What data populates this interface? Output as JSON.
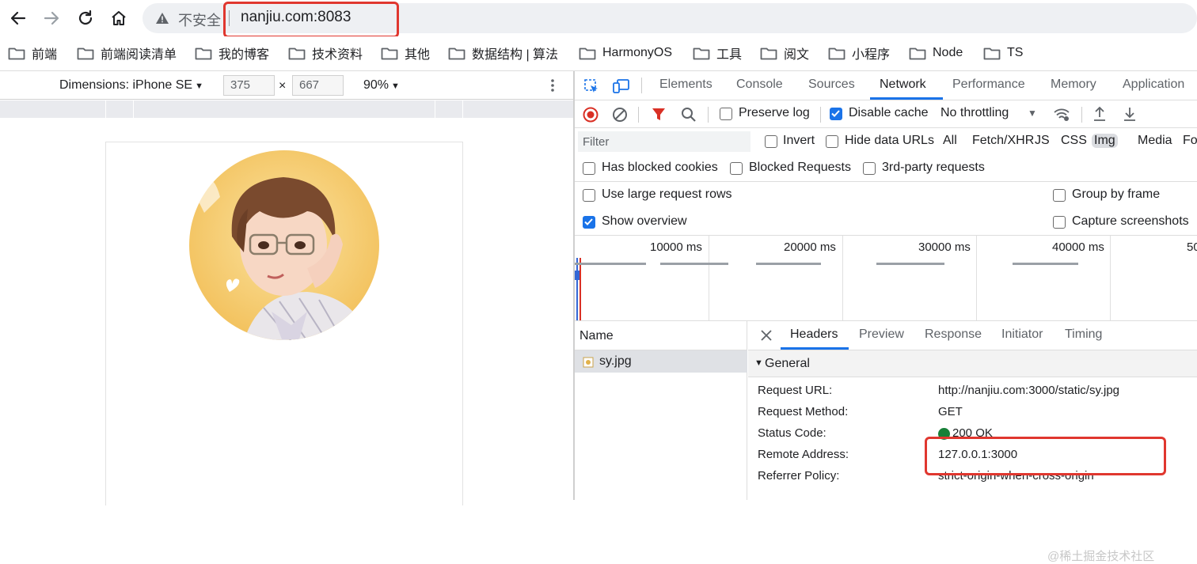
{
  "browser": {
    "security_label": "不安全",
    "address": "nanjiu.com:8083"
  },
  "bookmarks": [
    "前端",
    "前端阅读清单",
    "我的博客",
    "技术资料",
    "其他",
    "数据结构 | 算法",
    "HarmonyOS",
    "工具",
    "阅文",
    "小程序",
    "Node",
    "TS"
  ],
  "device_toolbar": {
    "device": "Dimensions: iPhone SE",
    "width": "375",
    "times": "×",
    "height": "667",
    "zoom": "90%"
  },
  "devtools": {
    "tabs": [
      "Elements",
      "Console",
      "Sources",
      "Network",
      "Performance",
      "Memory",
      "Application"
    ],
    "active_tab": "Network",
    "toolbar": {
      "preserve_log": "Preserve log",
      "disable_cache": "Disable cache",
      "throttling": "No throttling"
    },
    "filter": {
      "placeholder": "Filter",
      "invert": "Invert",
      "hide_data_urls": "Hide data URLs",
      "types": [
        "All",
        "Fetch/XHR",
        "JS",
        "CSS",
        "Img",
        "Media",
        "Fo"
      ],
      "active_type": "Img"
    },
    "options_row1": [
      "Has blocked cookies",
      "Blocked Requests",
      "3rd-party requests"
    ],
    "settings": {
      "large_rows": "Use large request rows",
      "group_by_frame": "Group by frame",
      "show_overview": "Show overview",
      "capture_screenshots": "Capture screenshots"
    },
    "timeline": {
      "labels": [
        "10000 ms",
        "20000 ms",
        "30000 ms",
        "40000 ms",
        "50"
      ]
    },
    "requests": {
      "column_name": "Name",
      "items": [
        "sy.jpg"
      ]
    },
    "details": {
      "tabs": [
        "Headers",
        "Preview",
        "Response",
        "Initiator",
        "Timing"
      ],
      "active_tab": "Headers",
      "section": "General",
      "rows": [
        {
          "key": "Request URL:",
          "value": "http://nanjiu.com:3000/static/sy.jpg"
        },
        {
          "key": "Request Method:",
          "value": "GET"
        },
        {
          "key": "Status Code:",
          "value": "200 OK"
        },
        {
          "key": "Remote Address:",
          "value": "127.0.0.1:3000"
        },
        {
          "key": "Referrer Policy:",
          "value": "strict-origin-when-cross-origin"
        }
      ]
    }
  },
  "watermark": "@稀土掘金技术社区",
  "colors": {
    "accent": "#1a73e8",
    "highlight_box": "#e0372f",
    "status_ok": "#188038",
    "record": "#d93025"
  }
}
